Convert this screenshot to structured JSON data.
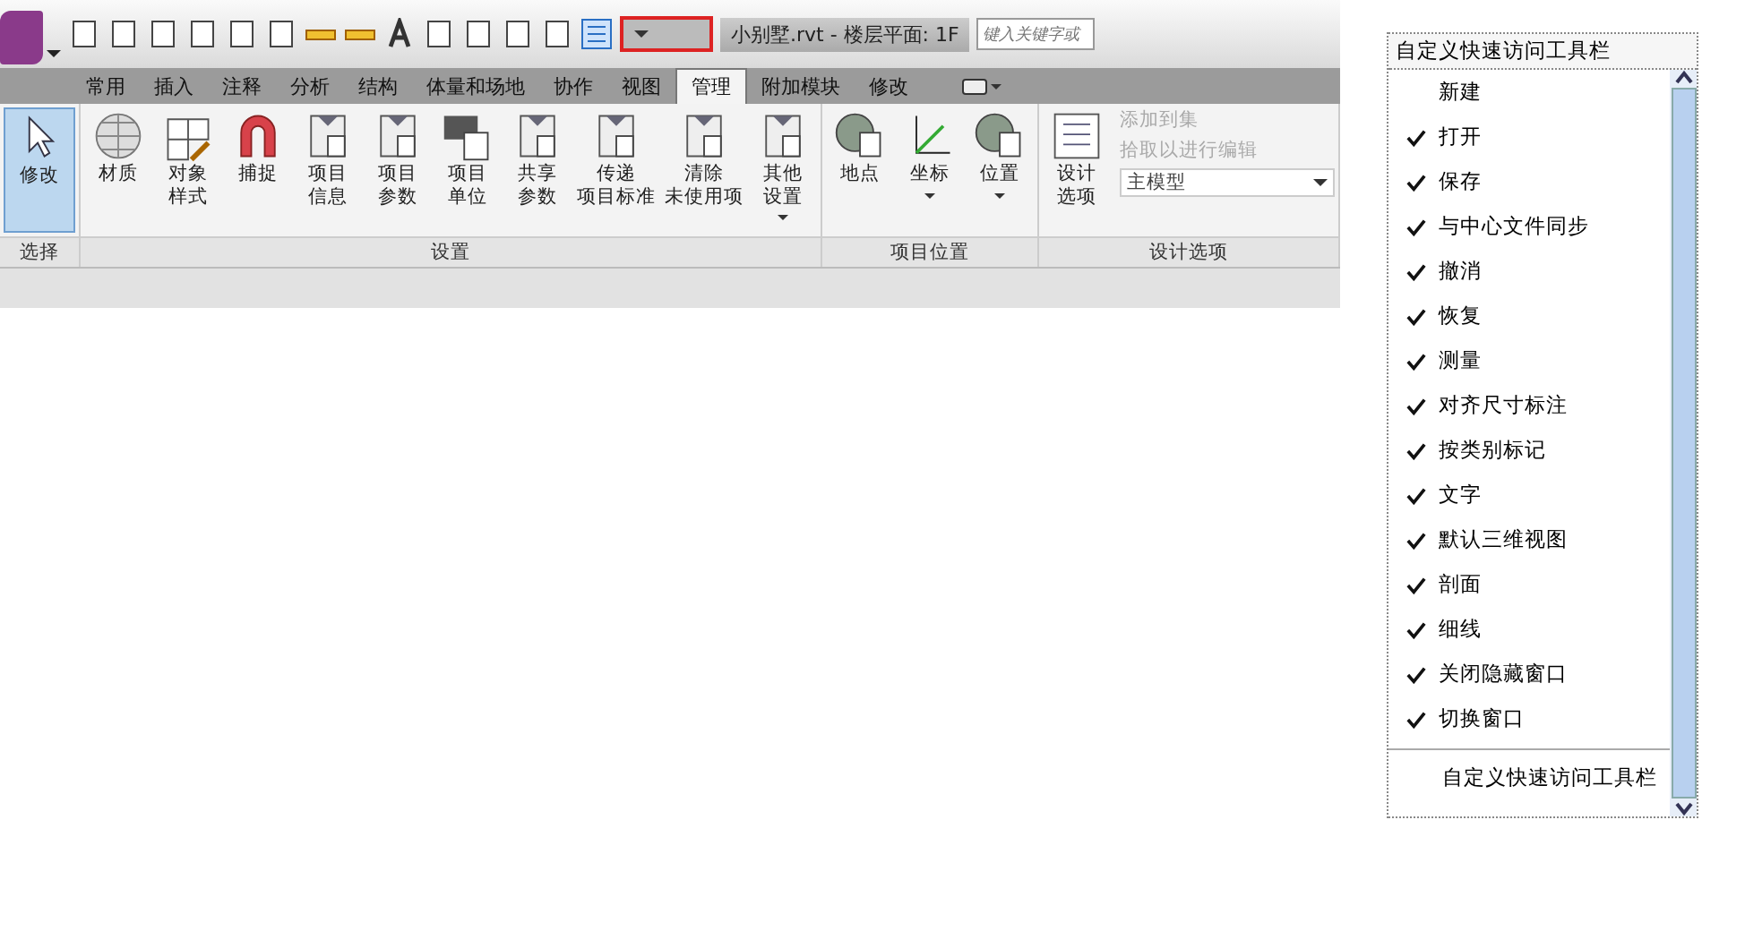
{
  "title_bar": {
    "document_title": "小别墅.rvt - 楼层平面: 1F",
    "search_placeholder": "键入关键字或"
  },
  "tabs": [
    {
      "label": "常用",
      "selected": false
    },
    {
      "label": "插入",
      "selected": false
    },
    {
      "label": "注释",
      "selected": false
    },
    {
      "label": "分析",
      "selected": false
    },
    {
      "label": "结构",
      "selected": false
    },
    {
      "label": "体量和场地",
      "selected": false
    },
    {
      "label": "协作",
      "selected": false
    },
    {
      "label": "视图",
      "selected": false
    },
    {
      "label": "管理",
      "selected": true
    },
    {
      "label": "附加模块",
      "selected": false
    },
    {
      "label": "修改",
      "selected": false
    }
  ],
  "panels": [
    {
      "title": "选择",
      "tools": [
        {
          "lines": [
            "修改"
          ],
          "selected": true,
          "dropdown": false
        }
      ]
    },
    {
      "title": "设置",
      "tools": [
        {
          "lines": [
            "材质"
          ],
          "selected": false,
          "dropdown": false
        },
        {
          "lines": [
            "对象",
            "样式"
          ],
          "selected": false,
          "dropdown": false
        },
        {
          "lines": [
            "捕捉"
          ],
          "selected": false,
          "dropdown": false
        },
        {
          "lines": [
            "项目",
            "信息"
          ],
          "selected": false,
          "dropdown": false
        },
        {
          "lines": [
            "项目",
            "参数"
          ],
          "selected": false,
          "dropdown": false
        },
        {
          "lines": [
            "项目",
            "单位"
          ],
          "selected": false,
          "dropdown": false
        },
        {
          "lines": [
            "共享",
            "参数"
          ],
          "selected": false,
          "dropdown": false
        },
        {
          "lines": [
            "传递",
            "项目标准"
          ],
          "selected": false,
          "dropdown": false
        },
        {
          "lines": [
            "清除",
            "未使用项"
          ],
          "selected": false,
          "dropdown": false
        },
        {
          "lines": [
            "其他",
            "设置"
          ],
          "selected": false,
          "dropdown": true
        }
      ]
    },
    {
      "title": "项目位置",
      "tools": [
        {
          "lines": [
            "地点"
          ],
          "selected": false,
          "dropdown": false
        },
        {
          "lines": [
            "坐标"
          ],
          "selected": false,
          "dropdown": true
        },
        {
          "lines": [
            "位置"
          ],
          "selected": false,
          "dropdown": true
        }
      ]
    }
  ],
  "design_options": {
    "title": "设计选项",
    "tool_lines": [
      "设计",
      "选项"
    ],
    "actions": [
      {
        "label": "添加到集",
        "disabled": true
      },
      {
        "label": "拾取以进行编辑",
        "disabled": true
      }
    ],
    "option_value": "主模型"
  },
  "menu": {
    "title": "自定义快速访问工具栏",
    "items": [
      {
        "label": "新建",
        "checked": false
      },
      {
        "label": "打开",
        "checked": true
      },
      {
        "label": "保存",
        "checked": true
      },
      {
        "label": "与中心文件同步",
        "checked": true
      },
      {
        "label": "撤消",
        "checked": true
      },
      {
        "label": "恢复",
        "checked": true
      },
      {
        "label": "测量",
        "checked": true
      },
      {
        "label": "对齐尺寸标注",
        "checked": true
      },
      {
        "label": "按类别标记",
        "checked": true
      },
      {
        "label": "文字",
        "checked": true
      },
      {
        "label": "默认三维视图",
        "checked": true
      },
      {
        "label": "剖面",
        "checked": true
      },
      {
        "label": "细线",
        "checked": true
      },
      {
        "label": "关闭隐藏窗口",
        "checked": true
      },
      {
        "label": "切换窗口",
        "checked": true
      }
    ],
    "footer": "自定义快速访问工具栏"
  }
}
